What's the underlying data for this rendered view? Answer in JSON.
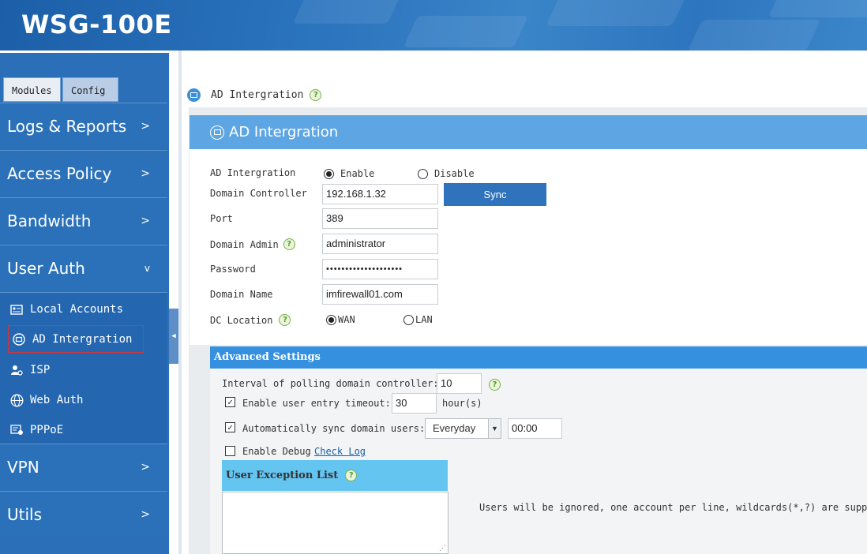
{
  "header": {
    "title": "WSG-100E"
  },
  "sidebar": {
    "tabs": {
      "modules": "Modules",
      "config": "Config"
    },
    "menu": {
      "logs": "Logs & Reports",
      "access": "Access Policy",
      "bandwidth": "Bandwidth",
      "userauth": "User Auth",
      "vpn": "VPN",
      "utils": "Utils"
    },
    "chevrons": {
      "closed": ">",
      "open": "v"
    },
    "submenu": {
      "local": "Local Accounts",
      "ad": "AD Intergration",
      "isp": "ISP",
      "webauth": "Web Auth",
      "pppoe": "PPPoE"
    }
  },
  "breadcrumb": {
    "label": "AD Intergration"
  },
  "panel": {
    "title": "AD Intergration"
  },
  "form": {
    "ad_label": "AD Intergration",
    "enable": "Enable",
    "disable": "Disable",
    "dc_label": "Domain Controller",
    "dc_value": "192.168.1.32",
    "sync": "Sync",
    "port_label": "Port",
    "port_value": "389",
    "admin_label": "Domain Admin",
    "admin_value": "administrator",
    "password_label": "Password",
    "password_value": "••••••••••••••••••••",
    "domain_label": "Domain Name",
    "domain_value": "imfirewall01.com",
    "location_label": "DC Location",
    "wan": "WAN",
    "lan": "LAN"
  },
  "advanced": {
    "title": "Advanced Settings",
    "interval_label": "Interval of polling domain controller:",
    "interval_value": "10",
    "timeout_label": "Enable user entry timeout:",
    "timeout_value": "30",
    "timeout_unit": "hour(s)",
    "autosync_label": "Automatically sync domain users:",
    "autosync_option": "Everyday",
    "autosync_time": "00:00",
    "debug_label": "Enable Debug",
    "check_log": "Check Log",
    "exception_title": "User Exception List",
    "exception_note": "Users will be ignored, one account per line, wildcards(*,?) are suppor"
  },
  "help_glyph": "?",
  "check_glyph": "✓",
  "colors": {
    "header": "#2a73bd",
    "sidebar": "#2a6fb7",
    "panel_head": "#5ea6e3",
    "adv_head": "#3591e0",
    "exc_head": "#65c5f1",
    "sync_btn": "#2f73bd"
  }
}
